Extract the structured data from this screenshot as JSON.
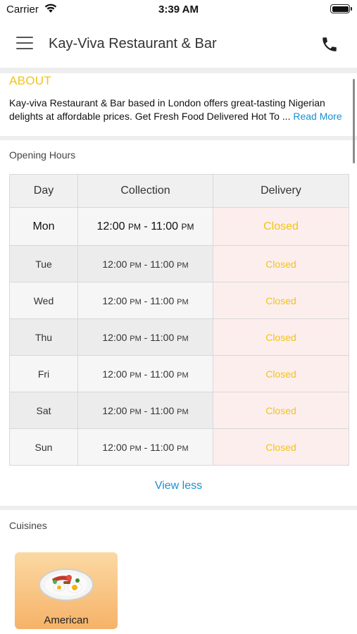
{
  "status_bar": {
    "carrier": "Carrier",
    "time": "3:39 AM"
  },
  "header": {
    "title": "Kay-Viva Restaurant & Bar",
    "menu_icon": "hamburger-icon",
    "call_icon": "phone-icon"
  },
  "about": {
    "title": "ABOUT",
    "text": "Kay-viva Restaurant & Bar based in London offers great-tasting Nigerian delights at affordable prices. Get Fresh Food Delivered Hot To  ... ",
    "read_more": "Read More"
  },
  "opening_hours": {
    "label": "Opening Hours",
    "columns": [
      "Day",
      "Collection",
      "Delivery"
    ],
    "rows": [
      {
        "day": "Mon",
        "open": "12:00",
        "open_ampm": "PM",
        "close": "11:00",
        "close_ampm": "PM",
        "delivery": "Closed"
      },
      {
        "day": "Tue",
        "open": "12:00",
        "open_ampm": "PM",
        "close": "11:00",
        "close_ampm": "PM",
        "delivery": "Closed"
      },
      {
        "day": "Wed",
        "open": "12:00",
        "open_ampm": "PM",
        "close": "11:00",
        "close_ampm": "PM",
        "delivery": "Closed"
      },
      {
        "day": "Thu",
        "open": "12:00",
        "open_ampm": "PM",
        "close": "11:00",
        "close_ampm": "PM",
        "delivery": "Closed"
      },
      {
        "day": "Fri",
        "open": "12:00",
        "open_ampm": "PM",
        "close": "11:00",
        "close_ampm": "PM",
        "delivery": "Closed"
      },
      {
        "day": "Sat",
        "open": "12:00",
        "open_ampm": "PM",
        "close": "11:00",
        "close_ampm": "PM",
        "delivery": "Closed"
      },
      {
        "day": "Sun",
        "open": "12:00",
        "open_ampm": "PM",
        "close": "11:00",
        "close_ampm": "PM",
        "delivery": "Closed"
      }
    ],
    "view_less": "View less"
  },
  "cuisines": {
    "label": "Cuisines",
    "items": [
      {
        "name": "American",
        "icon": "breakfast-plate-icon"
      }
    ]
  },
  "colors": {
    "accent": "#f0c419",
    "link": "#1a8fd1",
    "closed_bg": "#fdeeee"
  }
}
